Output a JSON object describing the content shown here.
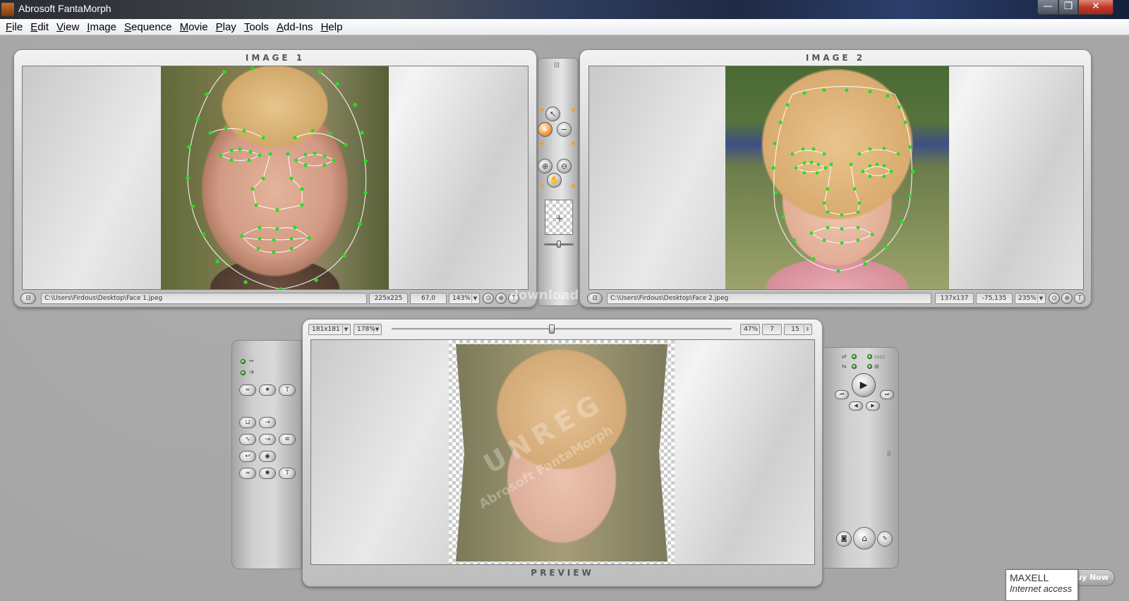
{
  "window": {
    "title": "Abrosoft FantaMorph",
    "controls": {
      "minimize": "—",
      "maximize": "❐",
      "close": "✕"
    }
  },
  "menu": [
    {
      "label": "File",
      "accel": "F",
      "rest": "ile"
    },
    {
      "label": "Edit",
      "accel": "E",
      "rest": "dit"
    },
    {
      "label": "View",
      "accel": "V",
      "rest": "iew"
    },
    {
      "label": "Image",
      "accel": "I",
      "rest": "mage"
    },
    {
      "label": "Sequence",
      "accel": "S",
      "rest": "equence"
    },
    {
      "label": "Movie",
      "accel": "M",
      "rest": "ovie"
    },
    {
      "label": "Play",
      "accel": "P",
      "rest": "lay"
    },
    {
      "label": "Tools",
      "accel": "T",
      "rest": "ools"
    },
    {
      "label": "Add-Ins",
      "accel": "A",
      "rest": "dd-Ins"
    },
    {
      "label": "Help",
      "accel": "H",
      "rest": "elp"
    }
  ],
  "image1": {
    "label": "IMAGE 1",
    "path": "C:\\Users\\Firdous\\Desktop\\Face 1.jpeg",
    "size": "225x225",
    "coords": "67,0",
    "zoom": "143%"
  },
  "image2": {
    "label": "IMAGE 2",
    "path": "C:\\Users\\Firdous\\Desktop\\Face 2.jpeg",
    "size": "137x137",
    "coords": "-75,135",
    "zoom": "235%"
  },
  "preview": {
    "label": "PREVIEW",
    "size": "181x181",
    "zoom": "178%",
    "progress": "47%",
    "frame": "7",
    "total_frames": "15",
    "progress_fraction": 0.47,
    "watermark": "UNREG",
    "watermark_sub": "Abrosoft FantaMorph"
  },
  "side_watermark": "download",
  "tooltip": {
    "title": "MAXELL",
    "subtitle": "Internet access"
  },
  "buy_now": "uy Now",
  "colors": {
    "mesh_line": "#ffffff",
    "mesh_point": "#22e022",
    "led_green": "#2ec71e",
    "led_orange": "#e8a23a"
  },
  "icons": {
    "tool_select": "arrow-icon",
    "tool_add": "add-point-icon",
    "tool_remove": "remove-point-icon",
    "zoom_in": "zoom-in-icon",
    "zoom_out": "zoom-out-icon",
    "pan": "hand-icon",
    "play": "play-icon"
  }
}
